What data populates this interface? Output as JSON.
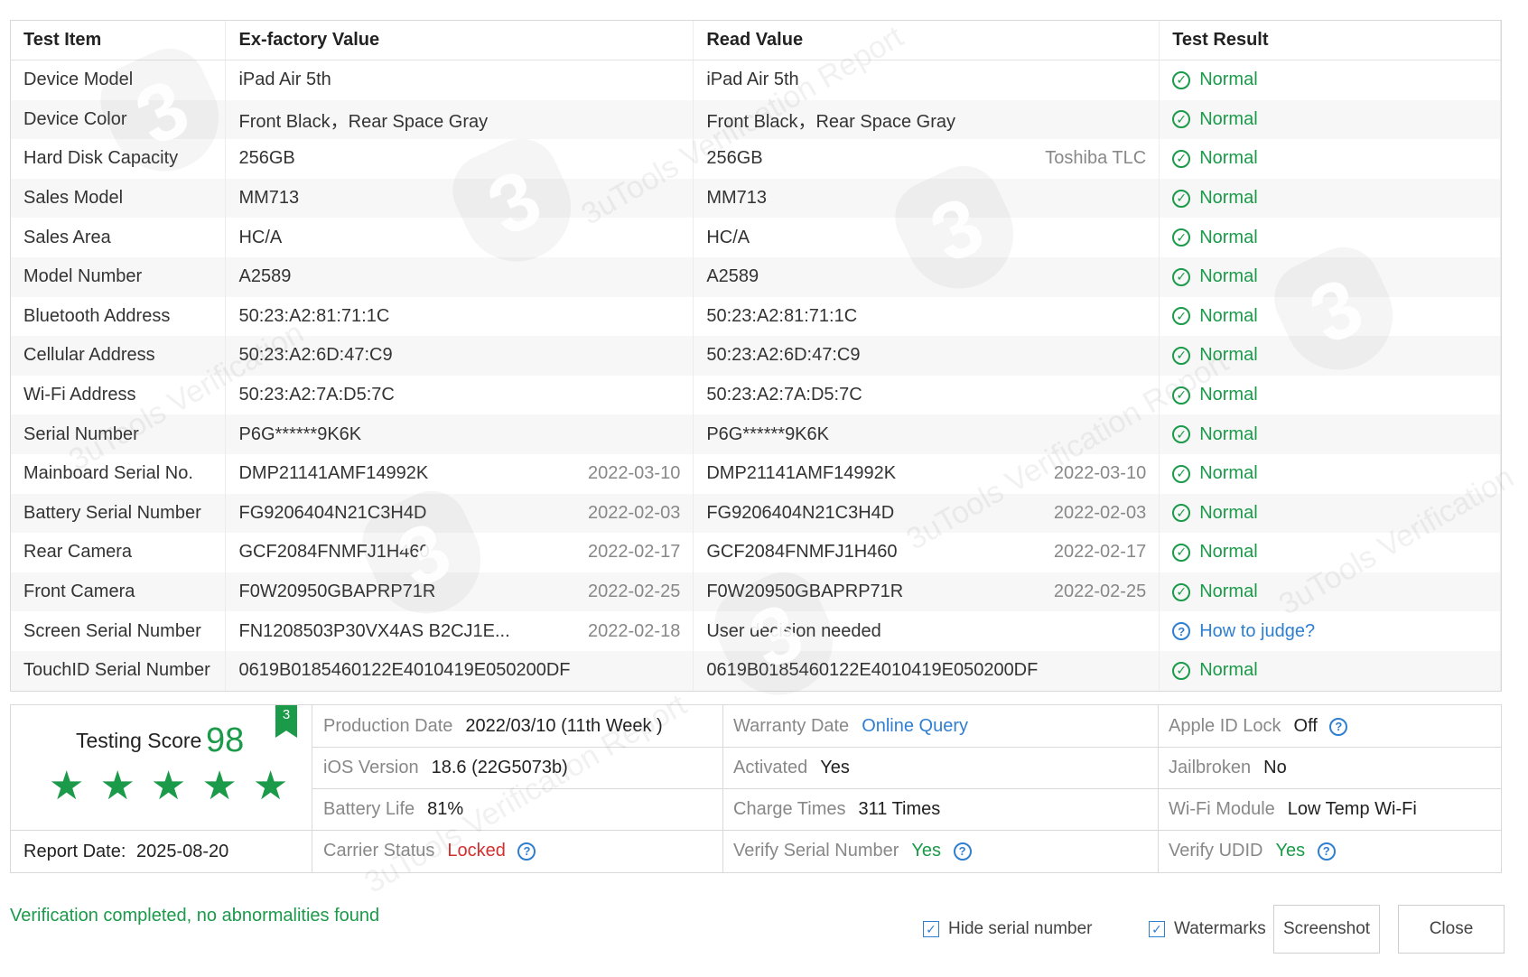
{
  "table": {
    "headers": [
      "Test Item",
      "Ex-factory Value",
      "Read Value",
      "Test Result"
    ],
    "rows": [
      {
        "item": "Device Model",
        "ex": "iPad Air 5th",
        "ex_date": "",
        "read": "iPad Air 5th",
        "read_date": "",
        "result": "Normal",
        "status": "ok"
      },
      {
        "item": "Device Color",
        "ex": "Front Black，Rear Space Gray",
        "ex_date": "",
        "read": "Front Black，Rear Space Gray",
        "read_date": "",
        "result": "Normal",
        "status": "ok"
      },
      {
        "item": "Hard Disk Capacity",
        "ex": "256GB",
        "ex_date": "",
        "read": "256GB",
        "read_date": "Toshiba TLC",
        "result": "Normal",
        "status": "ok"
      },
      {
        "item": "Sales Model",
        "ex": "MM713",
        "ex_date": "",
        "read": "MM713",
        "read_date": "",
        "result": "Normal",
        "status": "ok"
      },
      {
        "item": "Sales Area",
        "ex": "HC/A",
        "ex_date": "",
        "read": "HC/A",
        "read_date": "",
        "result": "Normal",
        "status": "ok"
      },
      {
        "item": "Model Number",
        "ex": "A2589",
        "ex_date": "",
        "read": "A2589",
        "read_date": "",
        "result": "Normal",
        "status": "ok"
      },
      {
        "item": "Bluetooth Address",
        "ex": "50:23:A2:81:71:1C",
        "ex_date": "",
        "read": "50:23:A2:81:71:1C",
        "read_date": "",
        "result": "Normal",
        "status": "ok"
      },
      {
        "item": "Cellular Address",
        "ex": "50:23:A2:6D:47:C9",
        "ex_date": "",
        "read": "50:23:A2:6D:47:C9",
        "read_date": "",
        "result": "Normal",
        "status": "ok"
      },
      {
        "item": "Wi-Fi Address",
        "ex": "50:23:A2:7A:D5:7C",
        "ex_date": "",
        "read": "50:23:A2:7A:D5:7C",
        "read_date": "",
        "result": "Normal",
        "status": "ok"
      },
      {
        "item": "Serial Number",
        "ex": "P6G******9K6K",
        "ex_date": "",
        "read": "P6G******9K6K",
        "read_date": "",
        "result": "Normal",
        "status": "ok"
      },
      {
        "item": "Mainboard Serial No.",
        "ex": "DMP21141AMF14992K",
        "ex_date": "2022-03-10",
        "read": "DMP21141AMF14992K",
        "read_date": "2022-03-10",
        "result": "Normal",
        "status": "ok"
      },
      {
        "item": "Battery Serial Number",
        "ex": "FG9206404N21C3H4D",
        "ex_date": "2022-02-03",
        "read": "FG9206404N21C3H4D",
        "read_date": "2022-02-03",
        "result": "Normal",
        "status": "ok"
      },
      {
        "item": "Rear Camera",
        "ex": "GCF2084FNMFJ1H460",
        "ex_date": "2022-02-17",
        "read": "GCF2084FNMFJ1H460",
        "read_date": "2022-02-17",
        "result": "Normal",
        "status": "ok"
      },
      {
        "item": "Front Camera",
        "ex": "F0W20950GBAPRP71R",
        "ex_date": "2022-02-25",
        "read": "F0W20950GBAPRP71R",
        "read_date": "2022-02-25",
        "result": "Normal",
        "status": "ok"
      },
      {
        "item": "Screen Serial Number",
        "ex": "FN1208503P30VX4AS B2CJ1E...",
        "ex_date": "2022-02-18",
        "read": "User decision needed",
        "read_date": "",
        "result": "How to judge?",
        "status": "question"
      },
      {
        "item": "TouchID Serial Number",
        "ex": "0619B0185460122E4010419E050200DF",
        "ex_date": "",
        "read": "0619B0185460122E4010419E050200DF",
        "read_date": "",
        "result": "Normal",
        "status": "ok"
      }
    ]
  },
  "score": {
    "label": "Testing Score",
    "value": "98",
    "badge": "3",
    "stars": 5,
    "report_date_label": "Report Date:",
    "report_date": "2025-08-20"
  },
  "info": {
    "production_date_label": "Production Date",
    "production_date": "2022/03/10 (11th Week )",
    "warranty_label": "Warranty Date",
    "warranty_link": "Online Query",
    "apple_id_label": "Apple ID Lock",
    "apple_id_value": "Off",
    "ios_label": "iOS Version",
    "ios_value": "18.6 (22G5073b)",
    "activated_label": "Activated",
    "activated_value": "Yes",
    "jailbroken_label": "Jailbroken",
    "jailbroken_value": "No",
    "battery_label": "Battery Life",
    "battery_value": "81%",
    "charge_label": "Charge Times",
    "charge_value": "311 Times",
    "wifi_label": "Wi-Fi Module",
    "wifi_value": "Low Temp Wi-Fi",
    "carrier_label": "Carrier Status",
    "carrier_value": "Locked",
    "verify_serial_label": "Verify Serial Number",
    "verify_serial_value": "Yes",
    "verify_udid_label": "Verify UDID",
    "verify_udid_value": "Yes"
  },
  "footer": {
    "message": "Verification completed, no abnormalities found",
    "hide_serial_label": "Hide serial number",
    "watermarks_label": "Watermarks",
    "screenshot_label": "Screenshot",
    "close_label": "Close"
  },
  "colors": {
    "accent_green": "#1b9a4a",
    "link_blue": "#2f7fd1",
    "alert_red": "#d32f2f"
  }
}
